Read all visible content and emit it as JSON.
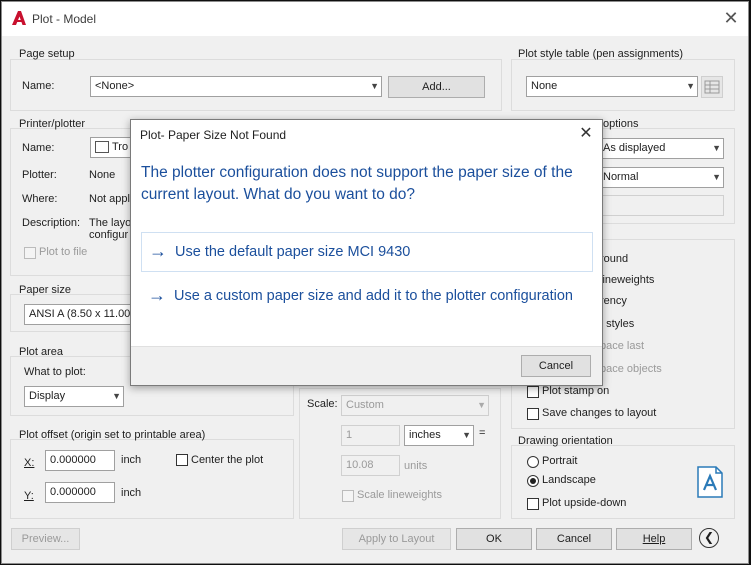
{
  "window": {
    "title": "Plot - Model"
  },
  "page_setup": {
    "group_label": "Page setup",
    "name_label": "Name:",
    "name_value": "<None>",
    "add_button": "Add..."
  },
  "plot_style": {
    "group_label": "Plot style table (pen assignments)",
    "value": "None"
  },
  "printer": {
    "group_label": "Printer/plotter",
    "name_label": "Name:",
    "name_value": "Tro",
    "plotter_label": "Plotter:",
    "plotter_value": "None",
    "where_label": "Where:",
    "where_value": "Not appl",
    "description_label": "Description:",
    "description_value_1": "The layo",
    "description_value_2": "configur",
    "plot_to_file": "Plot to file"
  },
  "shaded": {
    "partial_label": "options",
    "shade_value": "As displayed",
    "quality_value": "Normal"
  },
  "options": {
    "items": [
      "round",
      "lineweights",
      "rency",
      "t styles",
      "pace last",
      "pace objects"
    ],
    "plot_stamp": "Plot stamp on",
    "save_changes": "Save changes to layout"
  },
  "paper_size": {
    "group_label": "Paper size",
    "value": "ANSI A (8.50 x 11.00"
  },
  "plot_area": {
    "group_label": "Plot area",
    "what_label": "What to plot:",
    "what_value": "Display"
  },
  "plot_offset": {
    "group_label": "Plot offset (origin set to printable area)",
    "x_label": "X:",
    "x_value": "0.000000",
    "x_unit": "inch",
    "y_label": "Y:",
    "y_value": "0.000000",
    "y_unit": "inch",
    "center": "Center the plot"
  },
  "plot_scale": {
    "scale_label": "Scale:",
    "scale_value": "Custom",
    "num_value": "1",
    "unit_value": "inches",
    "eq": "=",
    "den_value": "10.08",
    "den_unit": "units",
    "scale_lw": "Scale lineweights"
  },
  "orientation": {
    "group_label": "Drawing orientation",
    "portrait": "Portrait",
    "landscape": "Landscape",
    "upside_down": "Plot upside-down"
  },
  "footer": {
    "preview": "Preview...",
    "apply": "Apply to Layout",
    "ok": "OK",
    "cancel": "Cancel",
    "help": "Help"
  },
  "alert": {
    "title": "Plot- Paper Size Not Found",
    "message": "The plotter configuration does not support the paper size of the current layout. What do you want to do?",
    "option1": "Use the default paper size MCI 9430",
    "option2": "Use a custom paper size and add it to the plotter configuration",
    "cancel": "Cancel"
  },
  "colors": {
    "accent_text": "#1b4f9c",
    "logo_red": "#c8102e"
  }
}
